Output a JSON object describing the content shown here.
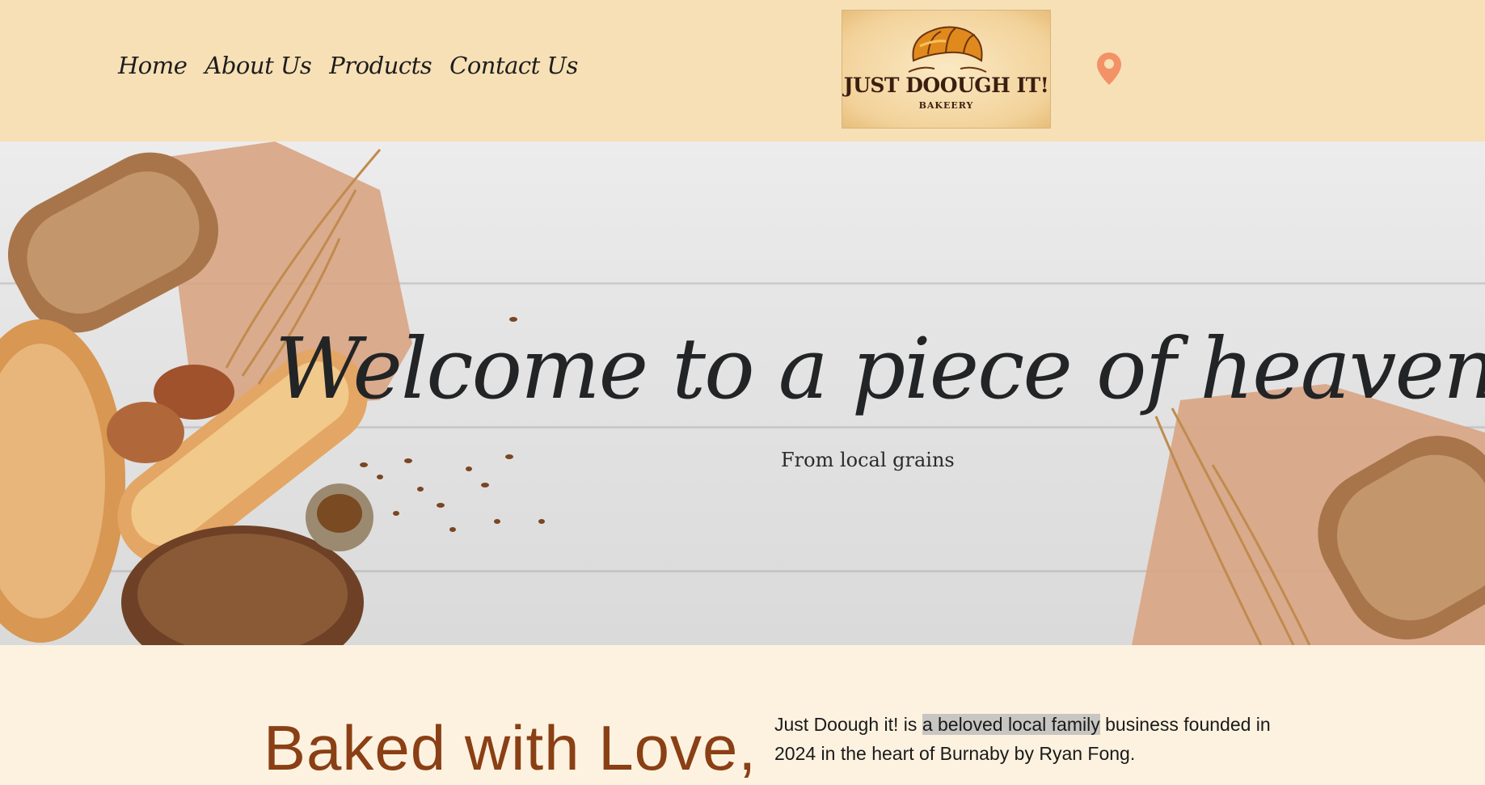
{
  "nav": {
    "items": [
      "Home",
      "About Us",
      "Products",
      "Contact Us"
    ]
  },
  "logo": {
    "brand": "JUST DOOUGH IT!",
    "subtitle": "BAKEERY",
    "icon": "croissant-icon"
  },
  "header": {
    "location_icon": "map-pin-icon",
    "location_color": "#f39167"
  },
  "hero": {
    "title": "Welcome to a piece of heaven",
    "subtitle": "From local grains"
  },
  "about": {
    "heading": "Baked with Love,",
    "text_before": "Just Doough it! is ",
    "text_highlight": "a beloved local family",
    "text_after": " business founded in 2024 in the heart of Burnaby by Ryan Fong."
  },
  "colors": {
    "header_bg": "#f7e0b6",
    "page_bg": "#fdf2e0",
    "heading_brown": "#8a3f14",
    "accent_orange": "#f39167"
  }
}
